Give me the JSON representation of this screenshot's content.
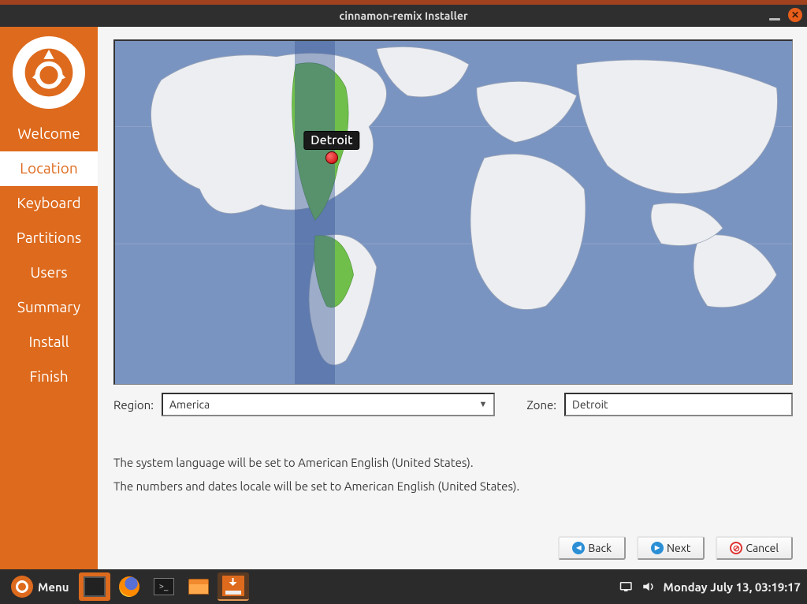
{
  "window": {
    "title": "cinnamon-remix Installer"
  },
  "sidebar": {
    "items": [
      {
        "label": "Welcome"
      },
      {
        "label": "Location"
      },
      {
        "label": "Keyboard"
      },
      {
        "label": "Partitions"
      },
      {
        "label": "Users"
      },
      {
        "label": "Summary"
      },
      {
        "label": "Install"
      },
      {
        "label": "Finish"
      }
    ],
    "active_index": 1
  },
  "map": {
    "pin_label": "Detroit"
  },
  "selectors": {
    "region_label": "Region:",
    "region_value": "America",
    "zone_label": "Zone:",
    "zone_value": "Detroit"
  },
  "info": {
    "line1": "The system language will be set to American English (United States).",
    "line2": "The numbers and dates locale will be set to American English (United States)."
  },
  "buttons": {
    "back": "Back",
    "next": "Next",
    "cancel": "Cancel"
  },
  "taskbar": {
    "menu_label": "Menu",
    "datetime": "Monday July 13, 03:19:17"
  }
}
